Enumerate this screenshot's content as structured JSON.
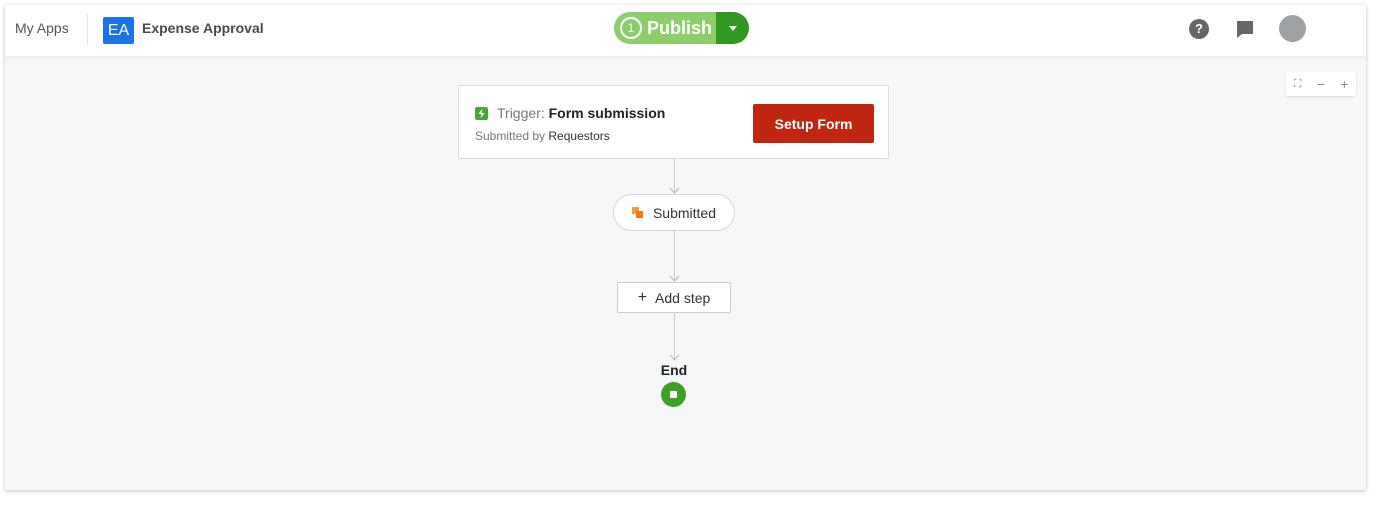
{
  "header": {
    "my_apps_label": "My Apps",
    "app_badge": "EA",
    "app_name": "Expense Approval",
    "publish": {
      "count": "1",
      "label": "Publish"
    }
  },
  "zoom_controls": {
    "fit": "⛶",
    "zoom_out": "−",
    "zoom_in": "+"
  },
  "flow": {
    "trigger": {
      "prefix": "Trigger:",
      "title": "Form submission",
      "sub_prefix": "Submitted by",
      "sub_value": "Requestors",
      "button_label": "Setup Form"
    },
    "state": {
      "label": "Submitted"
    },
    "add_step": {
      "label": "Add step"
    },
    "end": {
      "label": "End"
    }
  },
  "colors": {
    "accent_blue": "#1a73e8",
    "publish_green": "#8ccf6a",
    "publish_dark_green": "#2f9a1f",
    "setup_red": "#c0250f",
    "end_green": "#3ea024"
  }
}
